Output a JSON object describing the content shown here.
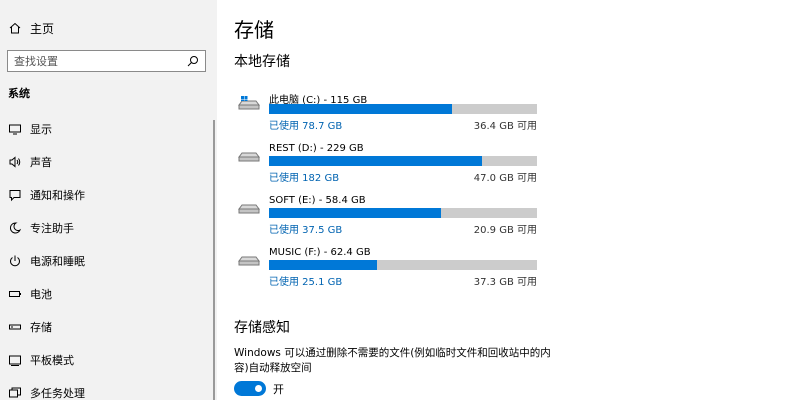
{
  "sidebar": {
    "home_label": "主页",
    "search_placeholder": "查找设置",
    "section_title": "系统",
    "items": [
      {
        "label": "显示",
        "icon": "display-icon"
      },
      {
        "label": "声音",
        "icon": "speaker-icon"
      },
      {
        "label": "通知和操作",
        "icon": "notification-icon"
      },
      {
        "label": "专注助手",
        "icon": "moon-icon"
      },
      {
        "label": "电源和睡眠",
        "icon": "power-icon"
      },
      {
        "label": "电池",
        "icon": "battery-icon"
      },
      {
        "label": "存储",
        "icon": "storage-icon"
      },
      {
        "label": "平板模式",
        "icon": "tablet-icon"
      },
      {
        "label": "多任务处理",
        "icon": "multitask-icon"
      }
    ]
  },
  "main": {
    "title": "存储",
    "local_title": "本地存储",
    "drives": [
      {
        "name": "此电脑 (C:) - 115 GB",
        "used": "已使用 78.7 GB",
        "available": "36.4 GB 可用",
        "fraction": 0.684,
        "system": true
      },
      {
        "name": "REST (D:) - 229 GB",
        "used": "已使用 182 GB",
        "available": "47.0 GB 可用",
        "fraction": 0.795,
        "system": false
      },
      {
        "name": "SOFT (E:) - 58.4 GB",
        "used": "已使用 37.5 GB",
        "available": "20.9 GB 可用",
        "fraction": 0.642,
        "system": false
      },
      {
        "name": "MUSIC (F:) - 62.4 GB",
        "used": "已使用 25.1 GB",
        "available": "37.3 GB 可用",
        "fraction": 0.402,
        "system": false
      }
    ],
    "sense": {
      "title": "存储感知",
      "description": "Windows 可以通过删除不需要的文件(例如临时文件和回收站中的内容)自动释放空间",
      "toggle_label": "开",
      "toggle_on": true
    }
  },
  "colors": {
    "accent": "#0078d7",
    "bar_bg": "#cccccc",
    "sidebar_bg": "#f2f2f2"
  }
}
